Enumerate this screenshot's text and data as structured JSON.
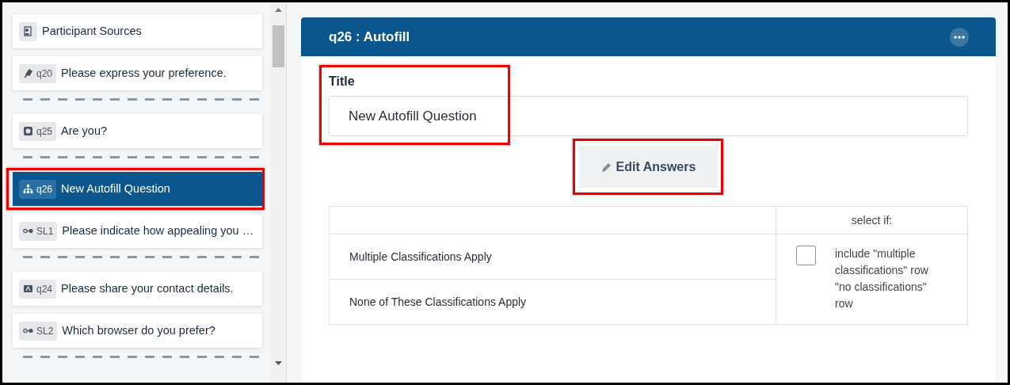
{
  "sidebar": {
    "items": [
      {
        "kind": "sources",
        "label": "Participant Sources",
        "selected": false,
        "highlighted": false
      },
      {
        "kind": "ranking",
        "code": "q20",
        "label": "Please express your preference.",
        "selected": false,
        "highlighted": false
      },
      {
        "kind": "divider"
      },
      {
        "kind": "radio",
        "code": "q25",
        "label": "Are you?",
        "selected": false,
        "highlighted": false
      },
      {
        "kind": "divider"
      },
      {
        "kind": "autofill",
        "code": "q26",
        "label": "New Autofill Question",
        "selected": true,
        "highlighted": true
      },
      {
        "kind": "slider",
        "code": "SL1",
        "label": "Please indicate how appealing you …",
        "selected": false,
        "highlighted": false
      },
      {
        "kind": "divider"
      },
      {
        "kind": "contact",
        "code": "q24",
        "label": "Please share your contact details.",
        "selected": false,
        "highlighted": false
      },
      {
        "kind": "slider",
        "code": "SL2",
        "label": "Which browser do you prefer?",
        "selected": false,
        "highlighted": false
      },
      {
        "kind": "divider"
      }
    ]
  },
  "editor": {
    "title": "q26 : Autofill",
    "title_field": {
      "label": "Title",
      "value": "New Autofill Question",
      "highlighted": true
    },
    "edit_button": {
      "label": "Edit Answers",
      "highlighted": true
    },
    "table": {
      "header": "select if:",
      "rows": [
        "Multiple Classifications Apply",
        "None of These Classifications Apply"
      ],
      "checkbox": {
        "checked": false,
        "label": "include \"multiple classifications\" row \"no classifications\" row"
      }
    }
  }
}
